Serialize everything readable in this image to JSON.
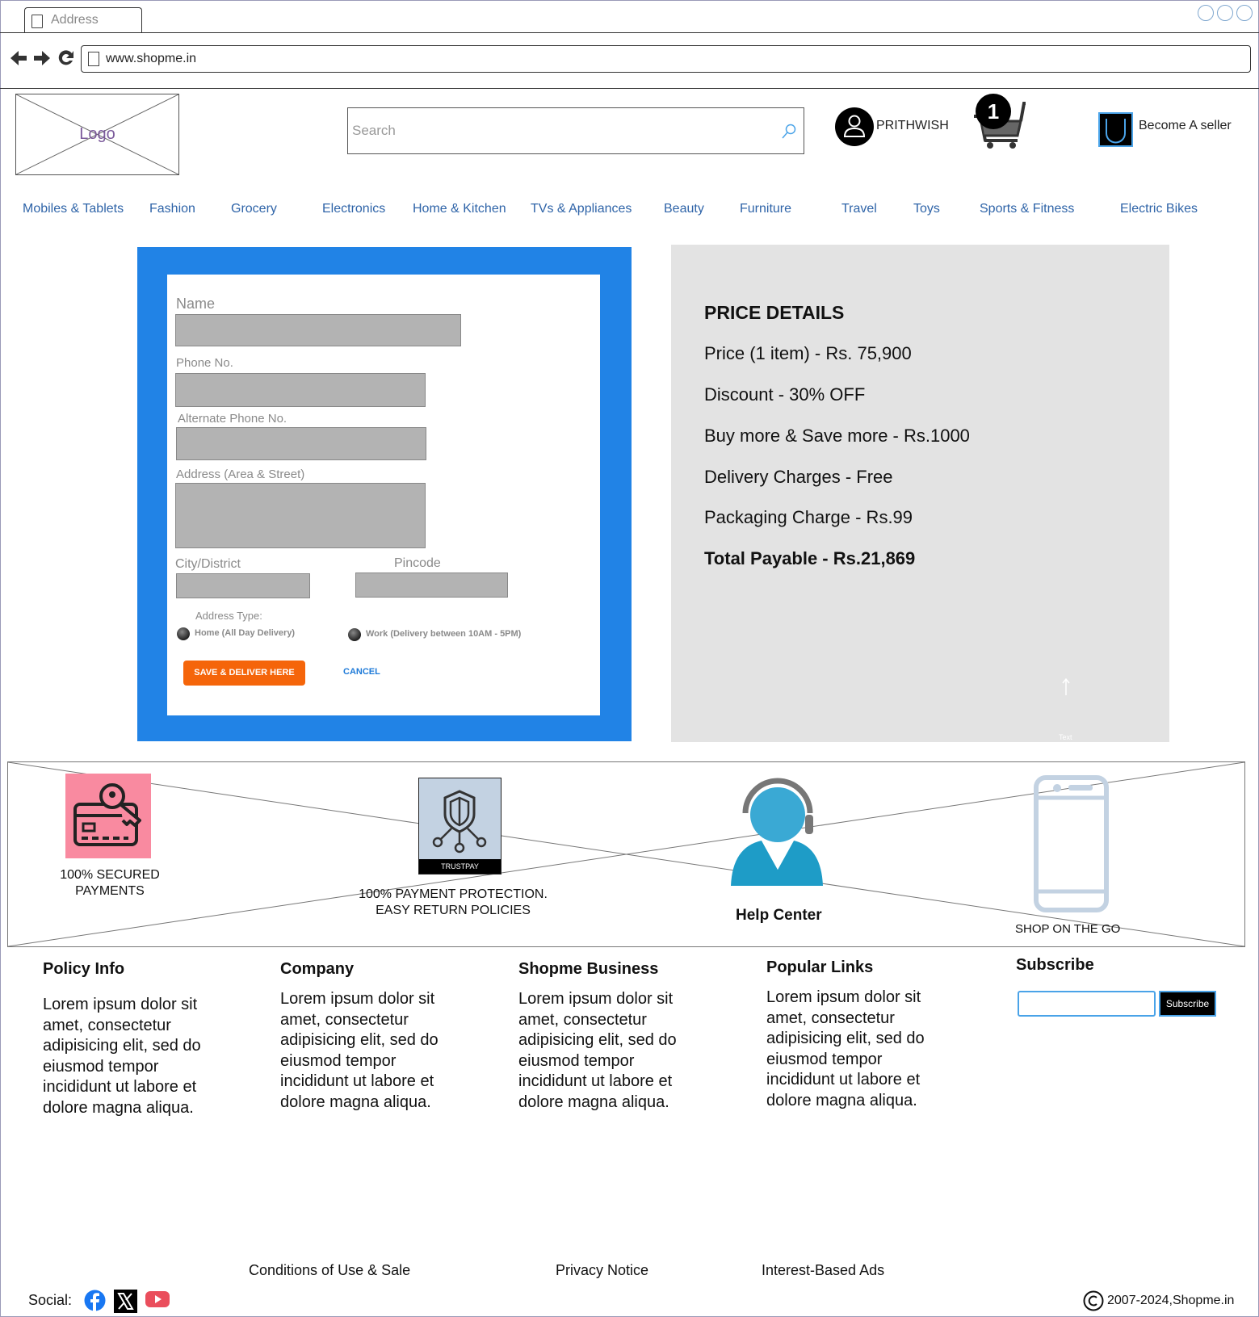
{
  "browser": {
    "tab_label": "Address",
    "url": "www.shopme.in"
  },
  "header": {
    "logo_text": "Logo",
    "search_placeholder": "Search",
    "username": "PRITHWISH",
    "cart_count": "1",
    "seller_label": "Become  A seller"
  },
  "categories": [
    "Mobiles & Tablets",
    "Fashion",
    "Grocery",
    "Electronics",
    "Home & Kitchen",
    "TVs & Appliances",
    "Beauty",
    "Furniture",
    "Travel",
    "Toys",
    "Sports & Fitness",
    "Electric Bikes"
  ],
  "form": {
    "name_label": "Name",
    "phone_label": "Phone No.",
    "alt_phone_label": "Alternate Phone No.",
    "address_label": "Address (Area & Street)",
    "city_label": "City/District",
    "pincode_label": "Pincode",
    "address_type_label": "Address Type:",
    "home_option": "Home (All Day Delivery)",
    "work_option": "Work (Delivery between 10AM - 5PM)",
    "save_button": "SAVE & DELIVER HERE",
    "cancel_button": "CANCEL"
  },
  "price_details": {
    "title": "PRICE DETAILS",
    "lines": [
      "Price (1 item) - Rs. 75,900",
      "Discount - 30% OFF",
      "Buy more & Save more - Rs.1000",
      "Delivery Charges - Free",
      "Packaging Charge - Rs.99"
    ],
    "total": "Total Payable - Rs.21,869",
    "placeholder_text": "Text"
  },
  "trust": {
    "secured_line1": "100% SECURED",
    "secured_line2": "PAYMENTS",
    "trustpay_caption": "TRUSTPAY",
    "protection_line1": "100% PAYMENT PROTECTION.",
    "protection_line2": "EASY RETURN POLICIES",
    "help_center": "Help Center",
    "shop_on_go": "SHOP ON THE GO"
  },
  "footer": {
    "columns": [
      {
        "heading": "Policy Info",
        "body": "Lorem ipsum dolor sit amet, consectetur adipisicing elit, sed do eiusmod tempor incididunt ut labore et dolore magna aliqua."
      },
      {
        "heading": "Company",
        "body": "Lorem ipsum dolor sit amet, consectetur adipisicing elit, sed do eiusmod tempor incididunt ut labore et dolore magna aliqua."
      },
      {
        "heading": "Shopme Business",
        "body": "Lorem ipsum dolor sit amet, consectetur adipisicing elit, sed do eiusmod tempor incididunt ut labore et dolore magna aliqua."
      },
      {
        "heading": "Popular Links",
        "body": "Lorem ipsum dolor sit amet, consectetur adipisicing elit, sed do eiusmod tempor incididunt ut labore et dolore magna aliqua."
      }
    ],
    "subscribe_heading": "Subscribe",
    "subscribe_button": "Subscribe",
    "links": [
      "Conditions of Use & Sale",
      "Privacy Notice",
      "Interest-Based Ads"
    ],
    "social_label": "Social:",
    "social_icons": [
      "facebook-icon",
      "x-icon",
      "youtube-icon"
    ],
    "copyright": "2007-2024,Shopme.in"
  },
  "colors": {
    "form_frame": "#2183e6",
    "save_button": "#f5650a",
    "category_link": "#2f64a8",
    "price_panel": "#e3e3e3"
  }
}
